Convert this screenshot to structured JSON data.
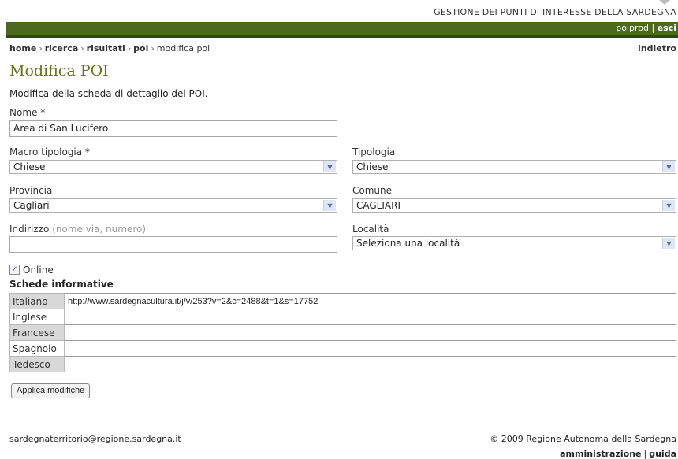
{
  "header": {
    "app_title": "GESTIONE DEI PUNTI DI INTERESSE DELLA SARDEGNA",
    "user": "poiprod",
    "separator": "|",
    "logout": "esci"
  },
  "breadcrumb": {
    "items": [
      "home",
      "ricerca",
      "risultati",
      "poi"
    ],
    "current": "modifica poi",
    "separator": "›",
    "back": "indietro"
  },
  "page": {
    "title": "Modifica POI",
    "intro": "Modifica della scheda di dettaglio del POI."
  },
  "form": {
    "nome_label": "Nome *",
    "nome_value": "Area di San Lucifero",
    "macro_label": "Macro tipologia *",
    "macro_value": "Chiese",
    "tipologia_label": "Tipologia",
    "tipologia_value": "Chiese",
    "provincia_label": "Provincia",
    "provincia_value": "Cagliari",
    "comune_label": "Comune",
    "comune_value": "CAGLIARI",
    "indirizzo_label": "Indirizzo",
    "indirizzo_hint": "(nome via, numero)",
    "indirizzo_value": "",
    "localita_label": "Località",
    "localita_value": "Seleziona una località",
    "online_label": "Online",
    "online_checked": true,
    "schede_title": "Schede informative",
    "schede": [
      {
        "lang": "Italiano",
        "url": "http://www.sardegnacultura.it/j/v/253?v=2&c=2488&t=1&s=17752"
      },
      {
        "lang": "Inglese",
        "url": ""
      },
      {
        "lang": "Francese",
        "url": ""
      },
      {
        "lang": "Spagnolo",
        "url": ""
      },
      {
        "lang": "Tedesco",
        "url": ""
      }
    ],
    "submit": "Applica modifiche"
  },
  "footer": {
    "email": "sardegnaterritorio@regione.sardegna.it",
    "copyright": "© 2009 Regione Autonoma della Sardegna",
    "link_admin": "amministrazione",
    "separator": "|",
    "link_help": "guida"
  },
  "colors": {
    "header_green": "#4b6a1f",
    "title_olive": "#6b6f1d"
  }
}
